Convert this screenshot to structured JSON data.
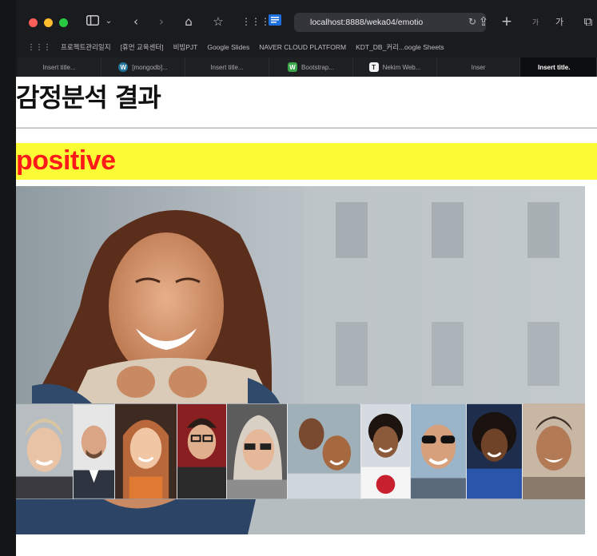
{
  "browser": {
    "url": "localhost:8888/weka04/emotio",
    "traffic_lights": {
      "close": "#ff5f57",
      "minimize": "#febc2e",
      "maximize": "#28c840"
    },
    "toolbar_right": {
      "tab_add": "+",
      "aa_small": "가",
      "aa_large": "가"
    }
  },
  "bookmarks": [
    "프로젝트관리일지",
    "[휴먼 교육센터]",
    "비빔PJT",
    "Google Slides",
    "NAVER CLOUD PLATFORM",
    "KDT_DB_커리...oogle Sheets"
  ],
  "tabs": [
    {
      "label": "Insert title...",
      "icon": ""
    },
    {
      "label": "[mongodb]...",
      "icon": "W"
    },
    {
      "label": "Insert title...",
      "icon": ""
    },
    {
      "label": "Bootstrap...",
      "icon": "W"
    },
    {
      "label": "Nekim Web...",
      "icon": "T"
    },
    {
      "label": "Inser",
      "icon": ""
    },
    {
      "label": "Insert title.",
      "icon": ""
    }
  ],
  "page": {
    "title": "감정분석 결과",
    "result_label": "positive",
    "result_bg": "#fbfb36",
    "result_color": "#ff1a1a"
  }
}
